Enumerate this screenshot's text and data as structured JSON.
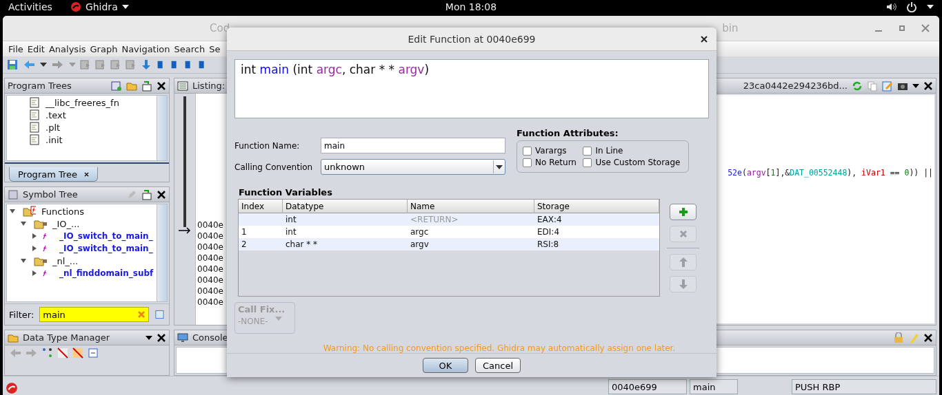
{
  "top_bar": {
    "activities": "Activities",
    "app_menu": "Ghidra",
    "clock": "Mon 18:08"
  },
  "window": {
    "title_left": "Cod",
    "title_right": "bin"
  },
  "menu": [
    "File",
    "Edit",
    "Analysis",
    "Graph",
    "Navigation",
    "Search",
    "Se"
  ],
  "program_trees": {
    "title": "Program Trees",
    "items": [
      "__libc_freeres_fn",
      ".text",
      ".plt",
      ".init"
    ],
    "tabs": [
      {
        "label": "Program Tree",
        "selected": true
      }
    ]
  },
  "symbol_tree": {
    "title": "Symbol Tree",
    "tree": [
      {
        "label": "Functions",
        "kind": "root",
        "expanded": true,
        "children": [
          {
            "label": "_IO_...",
            "kind": "folder",
            "expanded": true,
            "children": [
              {
                "label": "_IO_switch_to_main_",
                "kind": "function",
                "expanded": false
              },
              {
                "label": "_IO_switch_to_main_",
                "kind": "function",
                "expanded": false
              }
            ]
          },
          {
            "label": "_nl_...",
            "kind": "folder",
            "expanded": true,
            "children": [
              {
                "label": "_nl_finddomain_subf",
                "kind": "function",
                "expanded": false
              }
            ]
          }
        ]
      }
    ],
    "filter": {
      "label": "Filter:",
      "value": "main"
    }
  },
  "data_type_manager": {
    "title": "Data Type Manager"
  },
  "listing": {
    "title": "Listing:",
    "addresses": [
      "0040e",
      "0040e",
      "0040e",
      "0040e",
      "0040e",
      "0040e",
      "0040e",
      "0040e"
    ]
  },
  "decompiler": {
    "title": "23ca0442e294236bd...",
    "code": [
      {
        "text": "52e",
        "kind": "func"
      },
      {
        "text": "(",
        "kind": "plain"
      },
      {
        "text": "argv",
        "kind": "param"
      },
      {
        "text": "[",
        "kind": "plain"
      },
      {
        "text": "1",
        "kind": "const"
      },
      {
        "text": "],&",
        "kind": "plain"
      },
      {
        "text": "DAT_00552448",
        "kind": "global"
      },
      {
        "text": "), ",
        "kind": "plain"
      },
      {
        "text": "iVar1",
        "kind": "local"
      },
      {
        "text": " == ",
        "kind": "plain"
      },
      {
        "text": "0",
        "kind": "const"
      },
      {
        "text": ")) ||",
        "kind": "plain"
      }
    ]
  },
  "console": {
    "title": "Console"
  },
  "status_bar": {
    "address": "0040e699",
    "function": "main",
    "instruction": "PUSH RBP"
  },
  "dialog": {
    "title": "Edit Function at 0040e699",
    "signature": [
      {
        "text": "int ",
        "kind": "type"
      },
      {
        "text": "main",
        "kind": "name"
      },
      {
        "text": " (int ",
        "kind": "type"
      },
      {
        "text": "argc",
        "kind": "param"
      },
      {
        "text": ", char * * ",
        "kind": "type"
      },
      {
        "text": "argv",
        "kind": "param"
      },
      {
        "text": ")",
        "kind": "type"
      }
    ],
    "name_label": "Function Name:",
    "name_value": "main",
    "convention_label": "Calling Convention",
    "convention_value": "unknown",
    "attributes_title": "Function Attributes:",
    "attributes": [
      {
        "label": "Varargs",
        "checked": false
      },
      {
        "label": "In Line",
        "checked": false
      },
      {
        "label": "No Return",
        "checked": false
      },
      {
        "label": "Use Custom Storage",
        "checked": false
      }
    ],
    "variables_title": "Function Variables",
    "columns": [
      "Index",
      "Datatype",
      "Name",
      "Storage"
    ],
    "rows": [
      {
        "datatype": "int",
        "name": "<RETURN>",
        "storage": "EAX:4",
        "kind": "return"
      },
      {
        "index": "1",
        "datatype": "int",
        "name": "argc",
        "storage": "EDI:4",
        "kind": "param"
      },
      {
        "index": "2",
        "datatype": "char * *",
        "name": "argv",
        "storage": "RSI:8",
        "kind": "param"
      }
    ],
    "side_buttons": [
      {
        "kind": "add",
        "disabled": false
      },
      {
        "kind": "delete",
        "disabled": true
      },
      {
        "kind": "up",
        "disabled": true
      },
      {
        "kind": "down",
        "disabled": true
      }
    ],
    "call_fixup": {
      "label": "Call Fix...",
      "value": "-NONE-",
      "disabled": true
    },
    "warning": "Warning: No calling convention specified. Ghidra may automatically assign one later.",
    "buttons": [
      {
        "label": "OK",
        "default": true
      },
      {
        "label": "Cancel",
        "default": false
      }
    ]
  }
}
